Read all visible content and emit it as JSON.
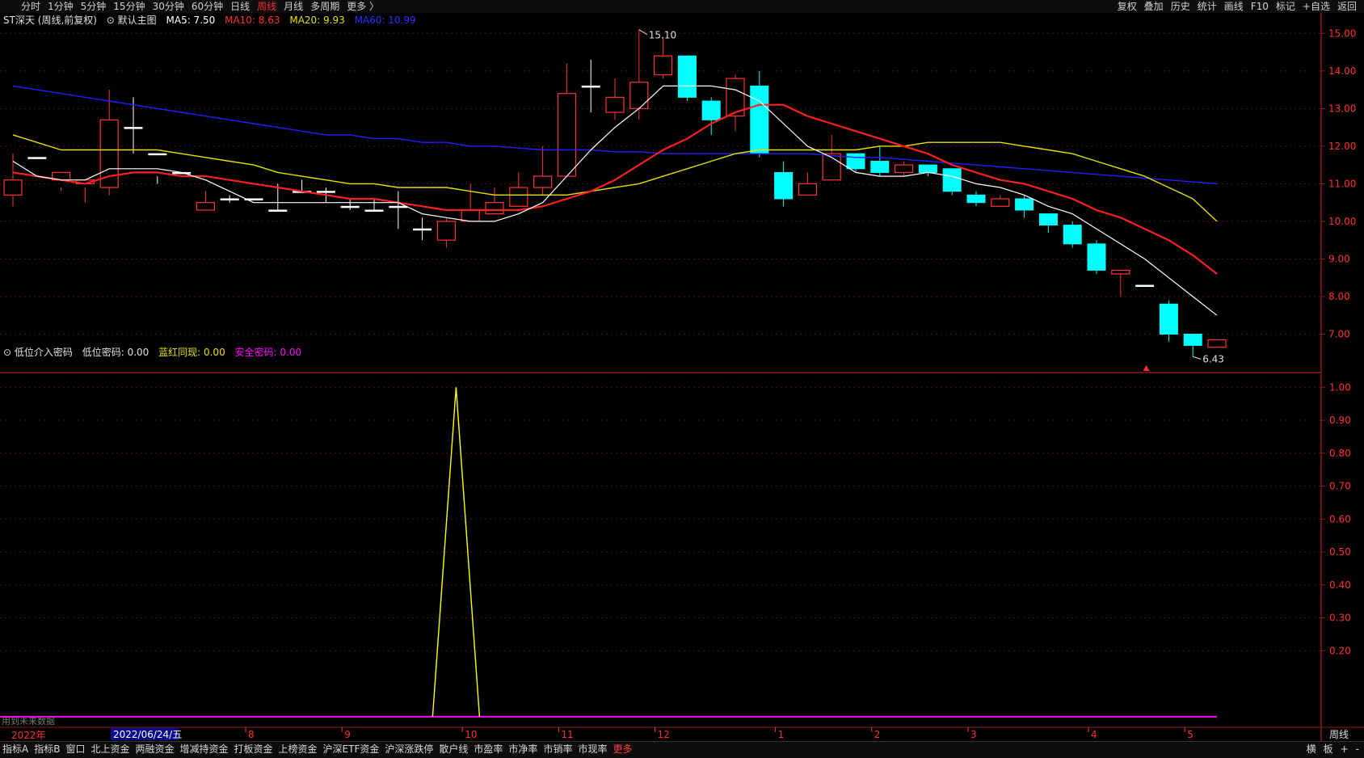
{
  "toolbar": {
    "left": [
      "分时",
      "1分钟",
      "5分钟",
      "15分钟",
      "30分钟",
      "60分钟",
      "日线",
      "周线",
      "月线",
      "多周期",
      "更多 〉"
    ],
    "active_index": 7,
    "right": [
      "复权",
      "叠加",
      "历史",
      "统计",
      "画线",
      "F10",
      "标记",
      "+自选",
      "返回"
    ]
  },
  "main_info": {
    "name": "ST深天 (周线,前复权)",
    "indicator": "默认主图",
    "ma5": "MA5: 7.50",
    "ma10": "MA10: 8.63",
    "ma20": "MA20: 9.93",
    "ma60": "MA60: 10.99"
  },
  "sub_info": {
    "name": "低位介入密码",
    "v1": "低位密码: 0.00",
    "v2": "蓝红同现: 0.00",
    "v3": "安全密码: 0.00"
  },
  "future_note": "用到未来数据",
  "date_axis": {
    "year": "2022年",
    "cursor": "2022/06/24/五",
    "months": [
      "8",
      "9",
      "10",
      "11",
      "12",
      "1",
      "2",
      "3",
      "4",
      "5"
    ],
    "period_label": "周线"
  },
  "bottom_tabs": [
    "指标A",
    "指标B",
    "窗口",
    "北上资金",
    "两融资金",
    "增减持资金",
    "打板资金",
    "上榜资金",
    "沪深ETF资金",
    "沪深涨跌停",
    "散户线",
    "市盈率",
    "市净率",
    "市销率",
    "市现率",
    "更多"
  ],
  "bottom_right": [
    "横",
    "板",
    "+",
    "-"
  ],
  "colors": {
    "up": "#ff3232",
    "down": "#00ffff",
    "ma5": "#ffffff",
    "ma10": "#ff2020",
    "ma20": "#e6e000",
    "ma60": "#2020ff",
    "sub_line": "#ffff00",
    "sub_base": "#ff00ff"
  },
  "chart_data": [
    {
      "type": "candlestick",
      "y_ticks": [
        "15.00",
        "14.00",
        "13.00",
        "12.00",
        "11.00",
        "10.00",
        "9.00",
        "8.00",
        "7.00"
      ],
      "ylim": [
        6.0,
        15.2
      ],
      "annotations": {
        "high": "15.10",
        "low": "6.43"
      },
      "candles": [
        [
          10.7,
          11.1,
          10.4,
          11.8
        ],
        [
          11.7,
          11.7,
          11.0,
          11.0
        ],
        [
          11.1,
          11.3,
          10.8,
          10.9
        ],
        [
          11.0,
          11.1,
          10.5,
          10.9
        ],
        [
          10.9,
          12.7,
          10.7,
          13.5
        ],
        [
          12.5,
          12.5,
          11.8,
          13.3
        ],
        [
          11.8,
          11.8,
          11.0,
          11.2
        ],
        [
          11.3,
          11.3,
          10.3,
          10.3
        ],
        [
          10.3,
          10.5,
          10.3,
          10.8
        ],
        [
          10.6,
          10.6,
          10.5,
          10.7
        ],
        [
          10.6,
          10.6,
          10.0,
          10.0
        ],
        [
          10.3,
          10.3,
          10.3,
          11.0
        ],
        [
          10.8,
          10.8,
          10.8,
          11.1
        ],
        [
          10.8,
          10.8,
          10.5,
          10.9
        ],
        [
          10.4,
          10.4,
          10.3,
          10.6
        ],
        [
          10.3,
          10.3,
          10.3,
          10.6
        ],
        [
          10.4,
          10.4,
          9.8,
          10.8
        ],
        [
          9.8,
          9.8,
          9.5,
          10.1
        ],
        [
          9.5,
          10.0,
          9.3,
          10.1
        ],
        [
          10.0,
          10.3,
          10.0,
          11.0
        ],
        [
          10.2,
          10.5,
          10.2,
          10.9
        ],
        [
          10.4,
          10.9,
          10.4,
          11.3
        ],
        [
          10.9,
          11.2,
          10.7,
          12.0
        ],
        [
          11.2,
          13.4,
          11.2,
          14.2
        ],
        [
          13.6,
          13.6,
          12.9,
          14.3
        ],
        [
          12.9,
          13.3,
          12.7,
          13.8
        ],
        [
          13.0,
          13.7,
          12.7,
          15.1
        ],
        [
          13.9,
          14.4,
          13.8,
          14.9
        ],
        [
          14.4,
          13.3,
          13.2,
          14.4
        ],
        [
          13.2,
          12.7,
          12.3,
          13.3
        ],
        [
          12.8,
          13.8,
          12.4,
          13.9
        ],
        [
          13.6,
          11.8,
          11.7,
          14.0
        ],
        [
          11.3,
          10.6,
          10.4,
          11.6
        ],
        [
          10.7,
          11.0,
          10.7,
          11.3
        ],
        [
          11.1,
          11.8,
          11.1,
          12.3
        ],
        [
          11.8,
          11.4,
          11.3,
          11.8
        ],
        [
          11.6,
          11.3,
          11.2,
          12.0
        ],
        [
          11.3,
          11.5,
          11.2,
          11.6
        ],
        [
          11.5,
          11.3,
          11.2,
          11.5
        ],
        [
          11.4,
          10.8,
          10.7,
          11.4
        ],
        [
          10.7,
          10.5,
          10.4,
          10.8
        ],
        [
          10.4,
          10.6,
          10.4,
          10.7
        ],
        [
          10.6,
          10.3,
          10.1,
          10.7
        ],
        [
          10.2,
          9.9,
          9.7,
          10.2
        ],
        [
          9.9,
          9.4,
          9.3,
          10.0
        ],
        [
          9.4,
          8.7,
          8.6,
          9.5
        ],
        [
          8.6,
          8.7,
          8.0,
          8.7
        ],
        [
          8.3,
          8.3,
          8.3,
          8.3
        ],
        [
          7.8,
          7.0,
          6.8,
          7.9
        ],
        [
          7.0,
          6.7,
          6.4,
          7.0
        ],
        [
          6.65,
          6.85,
          6.65,
          6.85
        ]
      ],
      "ma5": [
        11.6,
        11.2,
        11.1,
        11.1,
        11.4,
        11.4,
        11.4,
        11.3,
        11.1,
        10.8,
        10.5,
        10.5,
        10.5,
        10.5,
        10.5,
        10.5,
        10.5,
        10.2,
        10.1,
        10.0,
        10.0,
        10.2,
        10.5,
        11.2,
        11.9,
        12.5,
        13.0,
        13.6,
        13.6,
        13.6,
        13.5,
        13.2,
        12.6,
        12.0,
        11.7,
        11.3,
        11.2,
        11.2,
        11.3,
        11.2,
        11.0,
        10.9,
        10.7,
        10.4,
        10.2,
        9.8,
        9.4,
        9.0,
        8.5,
        8.0,
        7.5
      ],
      "ma10": [
        11.3,
        11.2,
        11.1,
        11.0,
        11.2,
        11.3,
        11.3,
        11.2,
        11.2,
        11.1,
        11.0,
        10.9,
        10.8,
        10.7,
        10.6,
        10.6,
        10.5,
        10.4,
        10.3,
        10.3,
        10.3,
        10.3,
        10.4,
        10.6,
        10.8,
        11.1,
        11.5,
        11.9,
        12.2,
        12.6,
        12.9,
        13.1,
        13.1,
        12.8,
        12.6,
        12.4,
        12.2,
        12.0,
        11.8,
        11.5,
        11.3,
        11.1,
        11.0,
        10.8,
        10.6,
        10.3,
        10.1,
        9.8,
        9.5,
        9.1,
        8.6
      ],
      "ma20": [
        12.3,
        12.1,
        11.9,
        11.9,
        11.9,
        11.9,
        11.9,
        11.8,
        11.7,
        11.6,
        11.5,
        11.3,
        11.2,
        11.1,
        11.0,
        11.0,
        10.9,
        10.9,
        10.9,
        10.8,
        10.7,
        10.7,
        10.7,
        10.7,
        10.8,
        10.9,
        11.0,
        11.2,
        11.4,
        11.6,
        11.8,
        11.9,
        11.9,
        11.9,
        11.9,
        11.9,
        12.0,
        12.0,
        12.1,
        12.1,
        12.1,
        12.1,
        12.0,
        11.9,
        11.8,
        11.6,
        11.4,
        11.2,
        10.9,
        10.6,
        10.0
      ],
      "ma60": [
        13.6,
        13.5,
        13.4,
        13.3,
        13.2,
        13.1,
        13.0,
        12.9,
        12.8,
        12.7,
        12.6,
        12.5,
        12.4,
        12.3,
        12.3,
        12.2,
        12.2,
        12.1,
        12.1,
        12.0,
        12.0,
        11.95,
        11.9,
        11.9,
        11.9,
        11.85,
        11.85,
        11.8,
        11.8,
        11.8,
        11.8,
        11.8,
        11.8,
        11.8,
        11.75,
        11.7,
        11.7,
        11.65,
        11.6,
        11.55,
        11.5,
        11.45,
        11.4,
        11.35,
        11.3,
        11.25,
        11.2,
        11.15,
        11.1,
        11.05,
        11.0
      ]
    },
    {
      "type": "line",
      "y_ticks": [
        "1.00",
        "0.90",
        "0.80",
        "0.70",
        "0.60",
        "0.50",
        "0.40",
        "0.30",
        "0.20"
      ],
      "ylim": [
        -0.02,
        1.04
      ],
      "spike_index": 18,
      "values": [
        0,
        0,
        0,
        0,
        0,
        0,
        0,
        0,
        0,
        0,
        0,
        0,
        0,
        0,
        0,
        0,
        0,
        0,
        1,
        0,
        0,
        0,
        0,
        0,
        0,
        0,
        0,
        0,
        0,
        0,
        0,
        0,
        0,
        0,
        0,
        0,
        0,
        0,
        0,
        0,
        0,
        0,
        0,
        0,
        0,
        0,
        0,
        0,
        0,
        0,
        0
      ]
    }
  ]
}
